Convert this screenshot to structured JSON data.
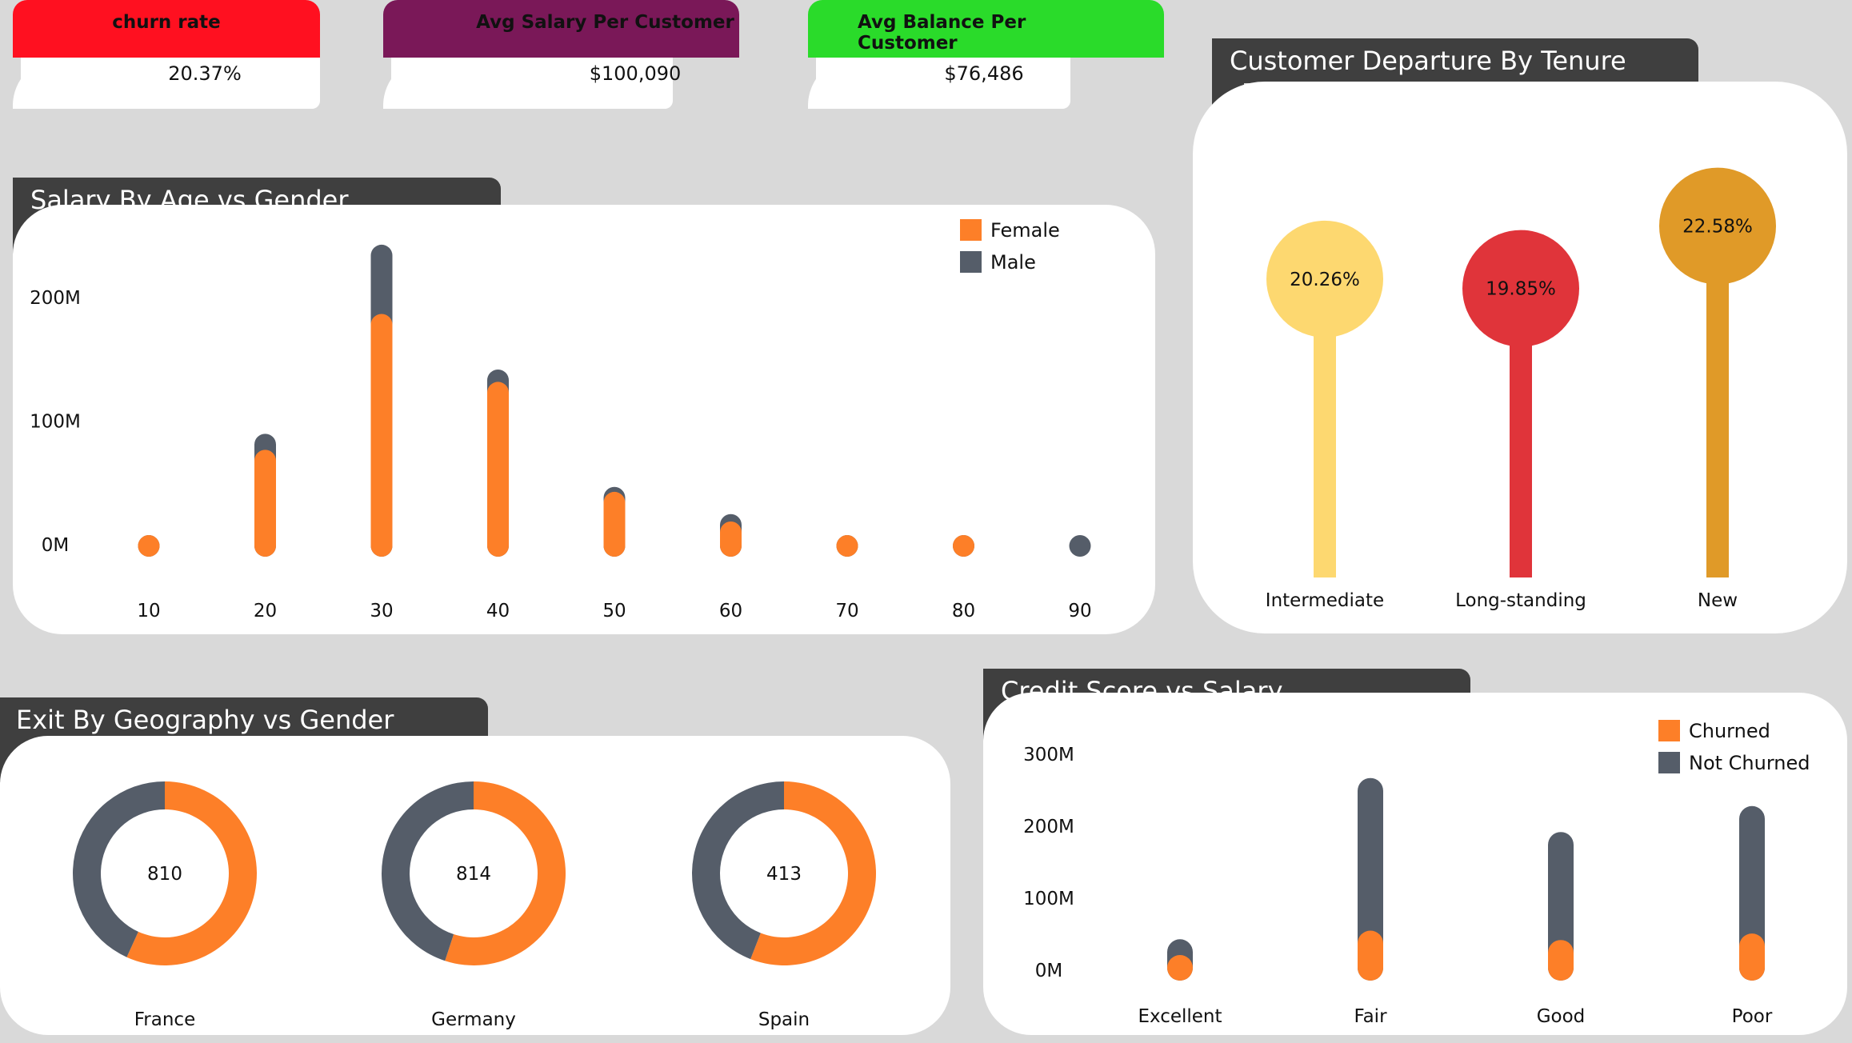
{
  "kpis": [
    {
      "label": "churn rate",
      "value": "20.37%",
      "color": "#ff1020"
    },
    {
      "label": "Avg Salary Per Customer",
      "value": "$100,090",
      "color": "#7a1858"
    },
    {
      "label": "Avg Balance  Per Customer",
      "value": "$76,486",
      "color": "#2adb2a"
    }
  ],
  "titles": {
    "salary_age": "Salary By Age vs Gender",
    "departure": "Customer Departure By Tenure",
    "geography": "Exit By Geography vs Gender",
    "credit": "Credit Score vs Salary"
  },
  "colors": {
    "female": "#fd7f28",
    "male": "#555d69",
    "churned": "#fd7f28",
    "not_churned": "#555d69"
  },
  "chart_data": [
    {
      "type": "bar",
      "title": "Salary By Age vs Gender",
      "categories": [
        "10",
        "20",
        "30",
        "40",
        "50",
        "60",
        "70",
        "80",
        "90"
      ],
      "series": [
        {
          "name": "Female",
          "values": [
            2,
            80,
            190,
            135,
            46,
            22,
            7,
            2,
            0
          ]
        },
        {
          "name": "Male",
          "values": [
            2,
            13,
            56,
            10,
            4,
            6,
            2,
            0,
            1
          ]
        }
      ],
      "y_ticks": [
        "0M",
        "100M",
        "200M"
      ],
      "ylim": [
        0,
        250
      ],
      "legend": "top-right",
      "stacked": true
    },
    {
      "type": "bar",
      "title": "Customer Departure By Tenure",
      "style": "lollipop",
      "categories": [
        "Intermediate",
        "Long-standing",
        "New"
      ],
      "values": [
        20.26,
        19.85,
        22.58
      ],
      "labels": [
        "20.26%",
        "19.85%",
        "22.58%"
      ],
      "colors": [
        "#fdd870",
        "#e0343a",
        "#e09a28"
      ],
      "label_colors": [
        "#222222",
        "#ffffff",
        "#222222"
      ]
    },
    {
      "type": "pie",
      "title": "Exit By Geography vs Gender",
      "style": "donut",
      "charts": [
        {
          "category": "France",
          "total": "810",
          "slices": [
            {
              "name": "Female",
              "value": 460
            },
            {
              "name": "Male",
              "value": 350
            }
          ]
        },
        {
          "category": "Germany",
          "total": "814",
          "slices": [
            {
              "name": "Female",
              "value": 448
            },
            {
              "name": "Male",
              "value": 366
            }
          ]
        },
        {
          "category": "Spain",
          "total": "413",
          "slices": [
            {
              "name": "Female",
              "value": 231
            },
            {
              "name": "Male",
              "value": 182
            }
          ]
        }
      ]
    },
    {
      "type": "bar",
      "title": "Credit Score vs Salary",
      "categories": [
        "Excellent",
        "Fair",
        "Good",
        "Poor"
      ],
      "series": [
        {
          "name": "Churned",
          "values": [
            13,
            55,
            42,
            51
          ]
        },
        {
          "name": "Not Churned",
          "values": [
            30,
            212,
            150,
            177
          ]
        }
      ],
      "y_ticks": [
        "0M",
        "100M",
        "200M",
        "300M"
      ],
      "ylim": [
        0,
        300
      ],
      "legend": "top-right",
      "stacked": true
    }
  ]
}
